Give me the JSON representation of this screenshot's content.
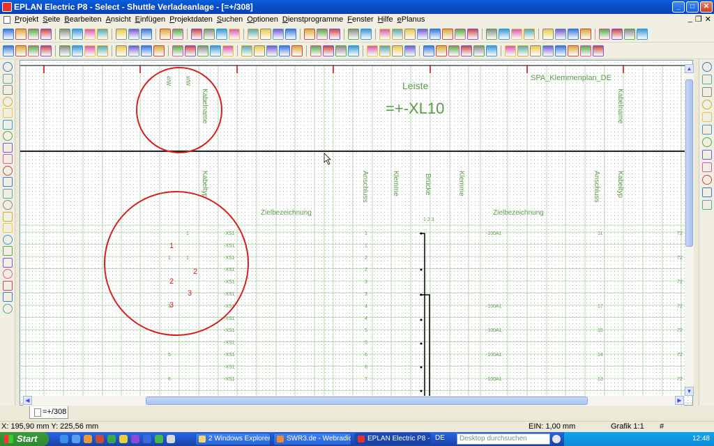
{
  "window": {
    "title": "EPLAN Electric P8 - Select - Shuttle Verladeanlage - [=+/308]",
    "btn_min": "_",
    "btn_max": "□",
    "btn_close": "✕"
  },
  "menu": {
    "items": [
      "Projekt",
      "Seite",
      "Bearbeiten",
      "Ansicht",
      "Einfügen",
      "Projektdaten",
      "Suchen",
      "Optionen",
      "Dienstprogramme",
      "Fenster",
      "Hilfe",
      "ePlanus"
    ],
    "mdi_min": "_",
    "mdi_restore": "❐",
    "mdi_close": "✕"
  },
  "drawing": {
    "form_name": "SPA_Klemmenplan_DE",
    "leiste_label": "Leiste",
    "leiste_value": "=+-XL10",
    "header_labels": {
      "kabelname_left": "Kabelname",
      "kabelname_right": "Kabelname",
      "kabeltyp_left": "Kabeltyp",
      "kabeltyp_right": "Kabeltyp",
      "anschluss_left": "Anschluss",
      "klemme_left": "Klemme",
      "bruecke": "Brücke",
      "klemme_right": "Klemme",
      "anschluss_right": "Anschluss",
      "ziel_left": "Zielbezeichnung",
      "ziel_right": "Zielbezeichnung"
    },
    "bruecke_sub": "1 2 3",
    "annotations": [
      "1",
      "2",
      "3",
      "2",
      "3"
    ],
    "rows": [
      {
        "col1": "",
        "col2": "1",
        "ziel": "-XS1",
        "anschl": "1",
        "ziel_r": "-100A1",
        "anschl_r": "11",
        "edge": "72"
      },
      {
        "col1": "",
        "col2": "",
        "ziel": "-XS1",
        "anschl": "1",
        "ziel_r": "",
        "anschl_r": "",
        "edge": ""
      },
      {
        "col1": "1",
        "col2": "1",
        "ziel": "-XS1",
        "anschl": "2",
        "ziel_r": "",
        "anschl_r": "",
        "edge": "72"
      },
      {
        "col1": "",
        "col2": "",
        "ziel": "-XS1",
        "anschl": "2",
        "ziel_r": "",
        "anschl_r": "",
        "edge": ""
      },
      {
        "col1": "",
        "col2": "",
        "ziel": "-XS1",
        "anschl": "3",
        "ziel_r": "",
        "anschl_r": "",
        "edge": "72"
      },
      {
        "col1": "",
        "col2": "",
        "ziel": "-XS1",
        "anschl": "3",
        "ziel_r": "",
        "anschl_r": "",
        "edge": ""
      },
      {
        "col1": "3",
        "col2": "",
        "ziel": "-XS1",
        "anschl": "4",
        "ziel_r": "-100A1",
        "anschl_r": "17",
        "edge": "72"
      },
      {
        "col1": "",
        "col2": "",
        "ziel": "-XS1",
        "anschl": "4",
        "ziel_r": "",
        "anschl_r": "",
        "edge": ""
      },
      {
        "col1": "",
        "col2": "",
        "ziel": "-XS1",
        "anschl": "5",
        "ziel_r": "-100A1",
        "anschl_r": "15",
        "edge": "72"
      },
      {
        "col1": "",
        "col2": "",
        "ziel": "-XS1",
        "anschl": "5",
        "ziel_r": "",
        "anschl_r": "",
        "edge": ""
      },
      {
        "col1": "5",
        "col2": "",
        "ziel": "-XS1",
        "anschl": "6",
        "ziel_r": "-100A1",
        "anschl_r": "14",
        "edge": "72"
      },
      {
        "col1": "",
        "col2": "",
        "ziel": "-XS1",
        "anschl": "6",
        "ziel_r": "",
        "anschl_r": "",
        "edge": ""
      },
      {
        "col1": "6",
        "col2": "",
        "ziel": "-XS1",
        "anschl": "7",
        "ziel_r": "-100A1",
        "anschl_r": "13",
        "edge": "72"
      }
    ]
  },
  "tabs": {
    "active": "=+/308"
  },
  "status": {
    "coords": "X: 195,90 mm  Y: 225,56 mm",
    "ein": "EIN: 1,00 mm",
    "grafik": "Grafik 1:1",
    "hash": "#"
  },
  "taskbar": {
    "start": "Start",
    "tasks": [
      {
        "label": "2 Windows Explorer",
        "icon": "folder-icon"
      },
      {
        "label": "SWR3.de - Webradio...",
        "icon": "firefox-icon"
      },
      {
        "label": "EPLAN Electric P8 - S...",
        "icon": "eplan-icon"
      }
    ],
    "lang": "DE",
    "search_placeholder": "Desktop durchsuchen",
    "clock": "12:48"
  },
  "colors": {
    "title_blue": "#0b4fc9",
    "drawing_green": "#5c9a4c",
    "grid_green": "#9ec895",
    "red_circle": "#d42020",
    "start_green": "#3c9a3c"
  }
}
